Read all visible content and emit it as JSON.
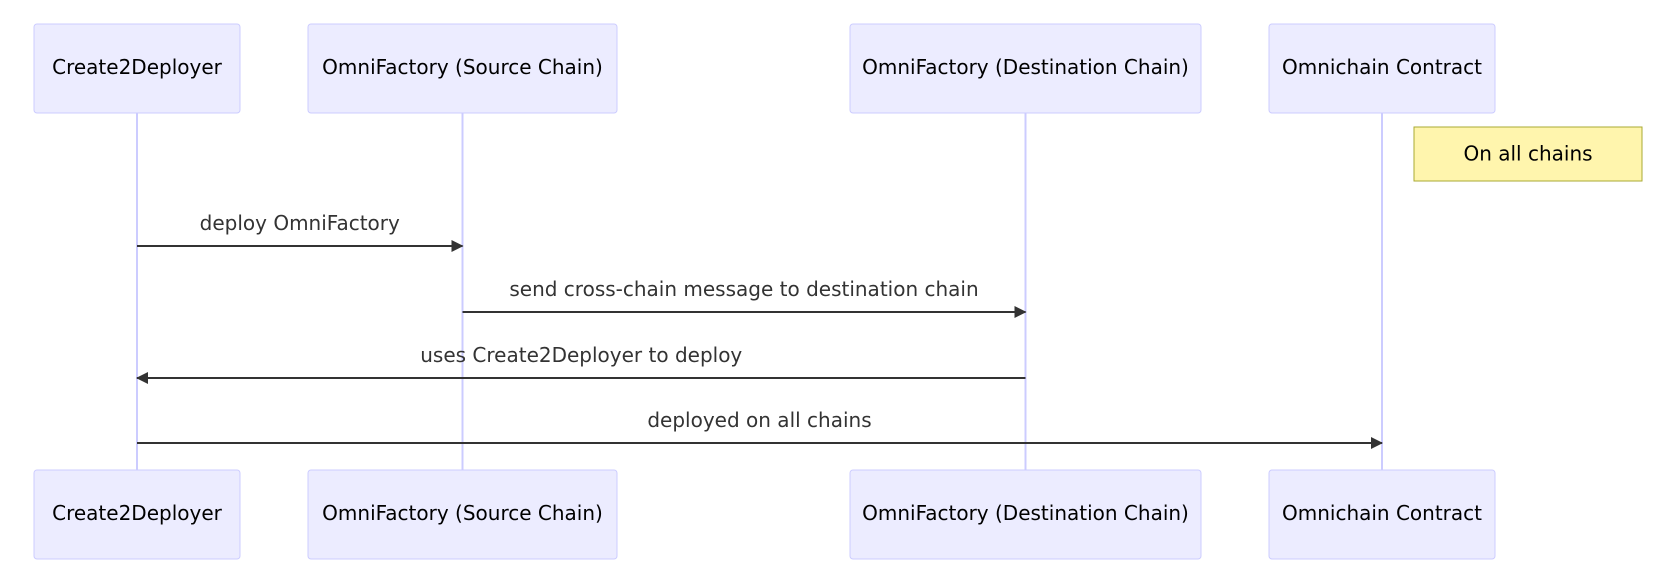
{
  "diagram": {
    "type": "sequence",
    "participants": [
      {
        "id": "c2d",
        "label": "Create2Deployer"
      },
      {
        "id": "src",
        "label": "OmniFactory (Source Chain)"
      },
      {
        "id": "dst",
        "label": "OmniFactory (Destination Chain)"
      },
      {
        "id": "occ",
        "label": "Omnichain Contract"
      }
    ],
    "note": {
      "over": "occ",
      "position": "right",
      "text": "On all chains"
    },
    "messages": [
      {
        "from": "c2d",
        "to": "src",
        "text": "deploy OmniFactory"
      },
      {
        "from": "src",
        "to": "dst",
        "text": "send cross-chain message to destination chain"
      },
      {
        "from": "dst",
        "to": "c2d",
        "text": "uses Create2Deployer to deploy"
      },
      {
        "from": "c2d",
        "to": "occ",
        "text": "deployed on all chains"
      }
    ],
    "colors": {
      "actor_fill": "#ECECFF",
      "actor_border": "#CCCCFF",
      "lifeline": "#CCCCFF",
      "message": "#333333",
      "note_fill": "#FFF5AD",
      "note_border": "#AAAA33"
    }
  }
}
